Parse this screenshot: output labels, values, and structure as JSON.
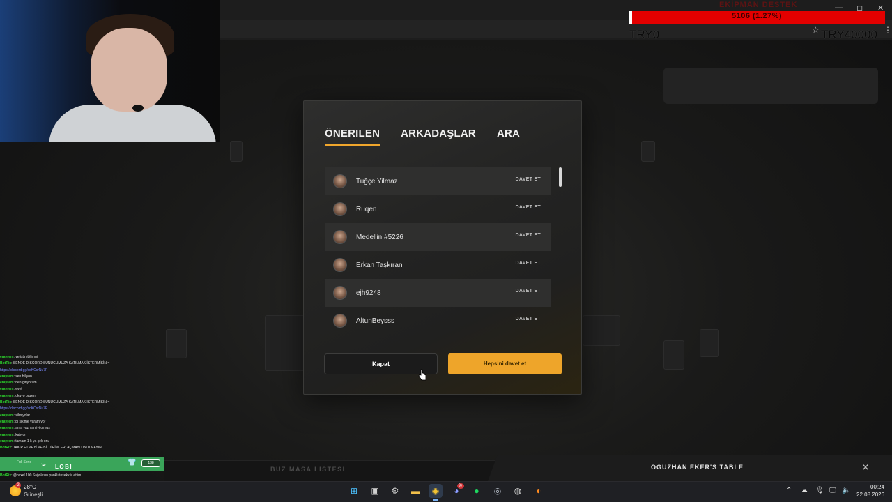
{
  "overlay": {
    "title": "EKİPMAN DESTEK",
    "progress_text": "5106 (1.27%)",
    "progress_percent": 1.27,
    "min_label": "TRY0",
    "max_label": "TRY40000"
  },
  "modal": {
    "tabs": [
      {
        "label": "ÖNERILEN",
        "active": true
      },
      {
        "label": "ARKADAŞLAR",
        "active": false
      },
      {
        "label": "ARA",
        "active": false
      }
    ],
    "invite_label": "DAVET ET",
    "players": [
      {
        "name": "Tuğçe Yilmaz"
      },
      {
        "name": "Ruqen"
      },
      {
        "name": "Medellin #5226"
      },
      {
        "name": "Erkan Taşkıran"
      },
      {
        "name": "ejh9248"
      },
      {
        "name": "AltunBeysss"
      }
    ],
    "close_label": "Kapat",
    "invite_all_label": "Hepsini davet et",
    "accent_color": "#eea52a"
  },
  "background": {
    "table_list_label": "BÜZ MASA LISTESI",
    "table_title": "OGUZHAN EKER'S TABLE"
  },
  "chat": {
    "lines": [
      {
        "user": "erayrem",
        "text": ": yetiştirebilir mi",
        "type": "user"
      },
      {
        "user": "BotRix",
        "text": ": SENDE DİSCORD SUNUCUMUZA KATILMAK İSTERMİSİN =",
        "type": "bot"
      },
      {
        "user": "",
        "text": "https://discord.gg/sqKCsrNu7F",
        "type": "link"
      },
      {
        "user": "erayrem",
        "text": ": sen biliyon",
        "type": "user"
      },
      {
        "user": "erayrem",
        "text": ": ben giriyorum",
        "type": "user"
      },
      {
        "user": "erayrem",
        "text": ": evet",
        "type": "user"
      },
      {
        "user": "erayrem",
        "text": ": okuyo bazen",
        "type": "user"
      },
      {
        "user": "BotRix",
        "text": ": SENDE DİSCORD SUNUCUMUZA KATILMAK İSTERMİSİN =",
        "type": "bot"
      },
      {
        "user": "",
        "text": "https://discord.gg/sqKCsrNu7F",
        "type": "link"
      },
      {
        "user": "erayrem",
        "text": ": silmiyolar",
        "type": "user"
      },
      {
        "user": "erayrem",
        "text": ": bi sikime yaramıyor",
        "type": "user"
      },
      {
        "user": "erayrem",
        "text": ": ama yazman iyi olmuş",
        "type": "user"
      },
      {
        "user": "erayrem",
        "text": ": kalıyor",
        "type": "user"
      },
      {
        "user": "erayrem",
        "text": ": tamam 1 k ya çek onu",
        "type": "user"
      },
      {
        "user": "BotRix",
        "text": ": TAKİP ETMEYİ VE BİLDİRİMLERİ AÇMAYI UNUTMAYIN.",
        "type": "bot"
      }
    ],
    "bottom_line_user": "BotRix",
    "bottom_line_text": ": @oxxel 100 Sağolasın panklı teşekkür ettim",
    "lobi_small": "Full Send",
    "lobi_label": "LOBİ",
    "lobi_toggle": "138"
  },
  "taskbar": {
    "temperature": "28°C",
    "weather": "Güneşli",
    "weather_badge": "2",
    "discord_badge": "9+",
    "time": "00:24",
    "date": "22.08.2026"
  }
}
